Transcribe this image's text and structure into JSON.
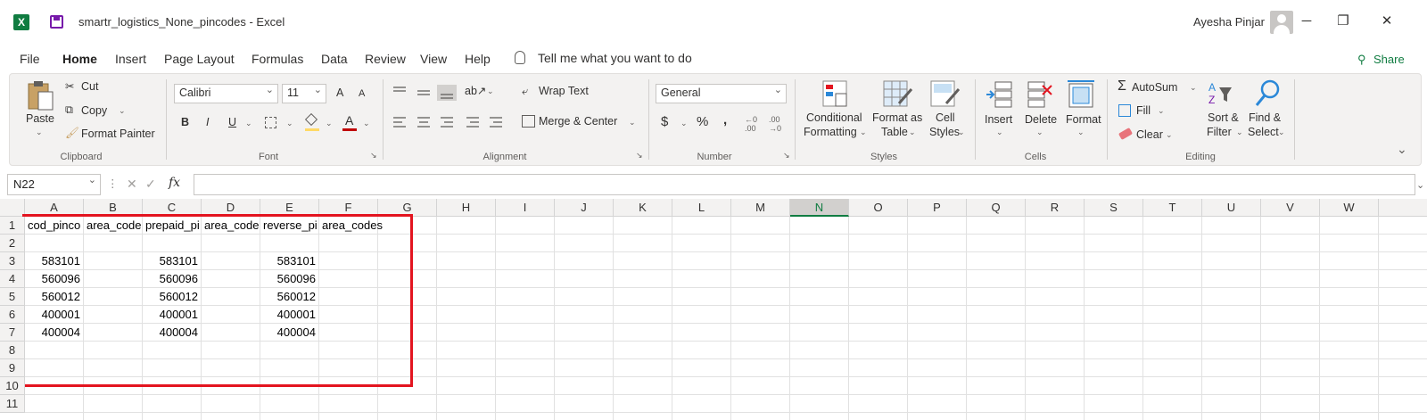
{
  "window": {
    "doc_title": "smartr_logistics_None_pincodes  -  Excel",
    "user_name": "Ayesha Pinjar",
    "app_logo_letter": "X",
    "minimize": "─",
    "restore": "❐",
    "close": "✕"
  },
  "menu": {
    "items": [
      "File",
      "Home",
      "Insert",
      "Page Layout",
      "Formulas",
      "Data",
      "Review",
      "View",
      "Help"
    ],
    "tell_me": "Tell me what you want to do",
    "share": "Share",
    "share_icon": "⚲"
  },
  "ribbon": {
    "clipboard": {
      "paste": "Paste",
      "cut": "Cut",
      "copy": "Copy",
      "format_painter": "Format Painter",
      "label": "Clipboard"
    },
    "font": {
      "name": "Calibri",
      "size": "11",
      "grow": "A",
      "shrink": "A",
      "bold": "B",
      "italic": "I",
      "underline": "U",
      "font_color": "A",
      "label": "Font"
    },
    "alignment": {
      "wrap_text": "Wrap Text",
      "merge_center": "Merge & Center",
      "label": "Alignment"
    },
    "number": {
      "format": "General",
      "currency": "$",
      "percent": "%",
      "comma": ",",
      "inc_dec": "←0 .00",
      "dec_dec": ".00 →0",
      "label": "Number"
    },
    "styles": {
      "conditional_1": "Conditional",
      "conditional_2": "Formatting",
      "format_table_1": "Format as",
      "format_table_2": "Table",
      "cell_styles_1": "Cell",
      "cell_styles_2": "Styles",
      "label": "Styles"
    },
    "cells": {
      "insert": "Insert",
      "delete": "Delete",
      "format": "Format",
      "label": "Cells"
    },
    "editing": {
      "autosum": "AutoSum",
      "fill": "Fill",
      "clear": "Clear",
      "sort_1": "Sort &",
      "sort_2": "Filter",
      "find_1": "Find &",
      "find_2": "Select",
      "label": "Editing"
    }
  },
  "formula_bar": {
    "name_box": "N22",
    "fx": "fx",
    "cancel": "✕",
    "enter": "✓",
    "value": ""
  },
  "sheet": {
    "columns": [
      "A",
      "B",
      "C",
      "D",
      "E",
      "F",
      "G",
      "H",
      "I",
      "J",
      "K",
      "L",
      "M",
      "N",
      "O",
      "P",
      "Q",
      "R",
      "S",
      "T",
      "U",
      "V",
      "W"
    ],
    "selected_column": "N",
    "rows": [
      "1",
      "2",
      "3",
      "4",
      "5",
      "6",
      "7",
      "8",
      "9",
      "10",
      "11"
    ],
    "headers": [
      "cod_pinco",
      "area_code",
      "prepaid_pi",
      "area_code",
      "reverse_pi",
      "area_codes"
    ],
    "data": [
      [
        "583101",
        "",
        "583101",
        "",
        "583101",
        ""
      ],
      [
        "560096",
        "",
        "560096",
        "",
        "560096",
        ""
      ],
      [
        "560012",
        "",
        "560012",
        "",
        "560012",
        ""
      ],
      [
        "400001",
        "",
        "400001",
        "",
        "400001",
        ""
      ],
      [
        "400004",
        "",
        "400004",
        "",
        "400004",
        ""
      ]
    ]
  },
  "colors": {
    "accent": "#107c41",
    "highlight": "#e3141f"
  }
}
